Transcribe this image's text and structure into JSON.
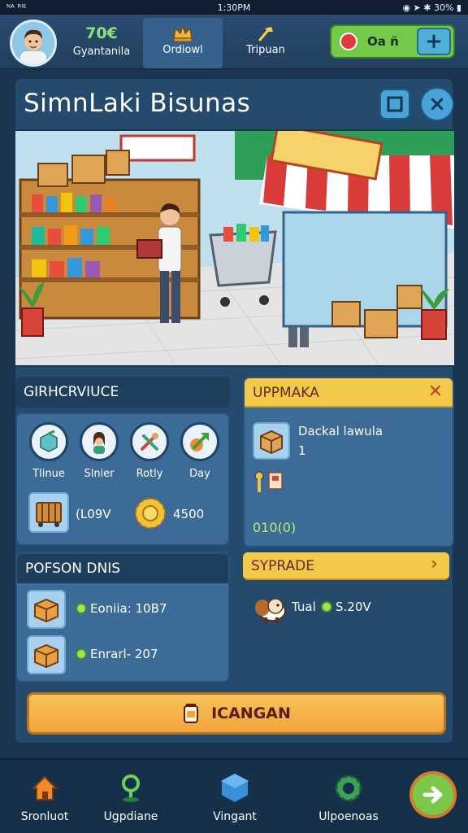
{
  "status": {
    "left": "ᴺᴬ ᴿᴵᴱ",
    "time": "1:30PM",
    "battery": "30%"
  },
  "topnav": {
    "money_amount": "70€",
    "money_label": "Gyantanila",
    "tabs": [
      {
        "label": "Ordiowl",
        "icon": "crown-icon",
        "active": true
      },
      {
        "label": "Tripuan",
        "icon": "hammer-icon",
        "active": false
      }
    ],
    "gems_value": "Oa ñ",
    "gems_plus": "+"
  },
  "panel": {
    "title": "SimnLaki Bisunas",
    "close_symbol": "×"
  },
  "services": {
    "title": "GIRHCRVIUCE",
    "categories": [
      {
        "label": "Tlinue",
        "icon": "box-icon"
      },
      {
        "label": "Slnier",
        "icon": "person-icon"
      },
      {
        "label": "Rotly",
        "icon": "tools-icon"
      },
      {
        "label": "Day",
        "icon": "arrow-up-icon"
      }
    ],
    "cart_value": "(L09V",
    "gear_value": "4500"
  },
  "upgrade_card": {
    "title": "UPPMAKA",
    "close_symbol": "✕",
    "item_name": "Dackal lawula",
    "item_count": "1",
    "progress_text": "010(0)"
  },
  "person_card": {
    "title": "POFSON DNIS",
    "rows": [
      {
        "text": "Eoniia: 10B7"
      },
      {
        "text": "Enrarl- 207"
      }
    ]
  },
  "syprade_card": {
    "title": "SYPRADE",
    "chevron": "›",
    "name": "Tual",
    "price": "S.20V"
  },
  "cta": {
    "label": "ICANGAN"
  },
  "bottomnav": [
    {
      "label": "Sronluot",
      "icon": "home-icon"
    },
    {
      "label": "Ugpdiane",
      "icon": "location-icon"
    },
    {
      "label": "Vingant",
      "icon": "cube-icon"
    },
    {
      "label": "Ulpoenoas",
      "icon": "gear-icon"
    }
  ],
  "colors": {
    "accent_gold": "#f3c94a",
    "panel_blue": "#244a6d",
    "go_green": "#7bc74a"
  }
}
